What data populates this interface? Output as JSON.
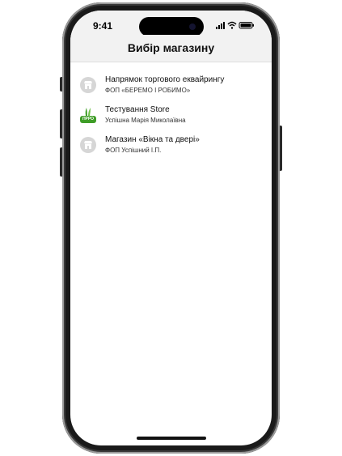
{
  "status_bar": {
    "time": "9:41"
  },
  "header": {
    "title": "Вибір магазину"
  },
  "stores": [
    {
      "name": "Напрямок торгового еквайрингу",
      "owner": "ФОП «БЕРЕМО І РОБИМО»",
      "icon": "store-icon"
    },
    {
      "name": "Тестування Store",
      "owner": "Успішна Марія Миколаївна",
      "icon": "prro-logo-icon",
      "badge": "ПРРО"
    },
    {
      "name": "Магазин «Вікна та двері»",
      "owner": "ФОП Успішний І.П.",
      "icon": "store-icon"
    }
  ],
  "colors": {
    "navbar_bg": "#f2f2f2",
    "prro_green": "#3f9d27",
    "icon_gray": "#d6d6d6"
  }
}
